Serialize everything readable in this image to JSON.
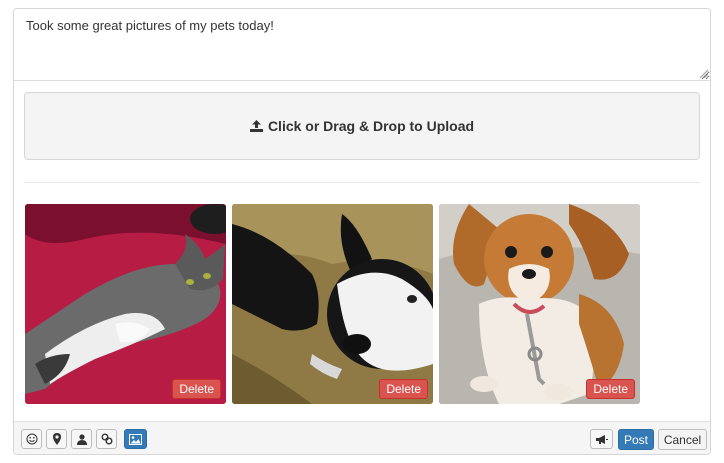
{
  "post": {
    "text": "Took some great pictures of my pets today!"
  },
  "upload": {
    "label": "Click or Drag & Drop to Upload",
    "icon": "upload-icon"
  },
  "photos": [
    {
      "subject": "tabby cat lying on red blanket",
      "delete_label": "Delete"
    },
    {
      "subject": "black and white boston terrier on grass",
      "delete_label": "Delete"
    },
    {
      "subject": "tan and white chihuahua on leash",
      "delete_label": "Delete"
    }
  ],
  "toolbar": {
    "tools": [
      {
        "icon": "smiley-icon",
        "active": false
      },
      {
        "icon": "map-pin-icon",
        "active": false
      },
      {
        "icon": "user-icon",
        "active": false
      },
      {
        "icon": "link-icon",
        "active": false
      },
      {
        "icon": "image-icon",
        "active": true
      }
    ],
    "announce_icon": "megaphone-icon",
    "post_label": "Post",
    "cancel_label": "Cancel"
  },
  "colors": {
    "primary": "#337ab7",
    "danger": "#d9534f"
  }
}
